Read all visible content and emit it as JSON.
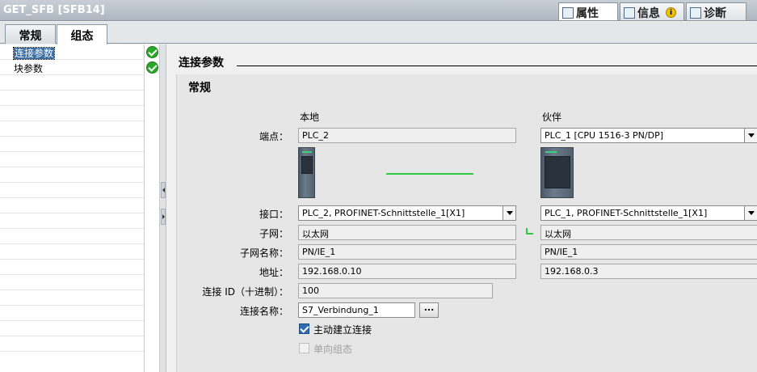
{
  "window": {
    "title": "GET_SFB [SFB14]"
  },
  "inspector_tabs": [
    {
      "label": "属性",
      "icon": "properties-icon",
      "active": true
    },
    {
      "label": "信息",
      "icon": "info-icon",
      "badge": "i",
      "active": false
    },
    {
      "label": "诊断",
      "icon": "diagnostics-icon",
      "active": false
    }
  ],
  "sub_tabs": [
    {
      "label": "常规",
      "active": false
    },
    {
      "label": "组态",
      "active": true
    }
  ],
  "nav": {
    "items": [
      {
        "label": "连接参数",
        "selected": true,
        "status": "ok"
      },
      {
        "label": "块参数",
        "selected": false,
        "status": "ok"
      }
    ]
  },
  "content": {
    "section_title": "连接参数",
    "group_title": "常规",
    "local_header": "本地",
    "partner_header": "伙伴",
    "labels": {
      "endpoint": "端点：",
      "interface": "接口：",
      "subnet": "子网：",
      "subnet_name": "子网名称：",
      "address": "地址：",
      "connection_id": "连接 ID（十进制）：",
      "connection_name": "连接名称："
    },
    "local": {
      "endpoint": "PLC_2",
      "interface": "PLC_2, PROFINET-Schnittstelle_1[X1]",
      "subnet": "以太网",
      "subnet_name": "PN/IE_1",
      "address": "192.168.0.10"
    },
    "partner": {
      "endpoint": "PLC_1 [CPU 1516-3 PN/DP]",
      "interface": "PLC_1, PROFINET-Schnittstelle_1[X1]",
      "subnet": "以太网",
      "subnet_name": "PN/IE_1",
      "address": "192.168.0.3"
    },
    "connection_id": "100",
    "connection_name": "S7_Verbindung_1",
    "browse_label": "...",
    "active_connection": {
      "label": "主动建立连接",
      "checked": true
    },
    "one_way": {
      "label": "单向组态",
      "checked": false,
      "disabled": true
    }
  },
  "colors": {
    "link": "#2ecc40",
    "selection": "#3a6ea5",
    "ok": "#2aa82a"
  }
}
